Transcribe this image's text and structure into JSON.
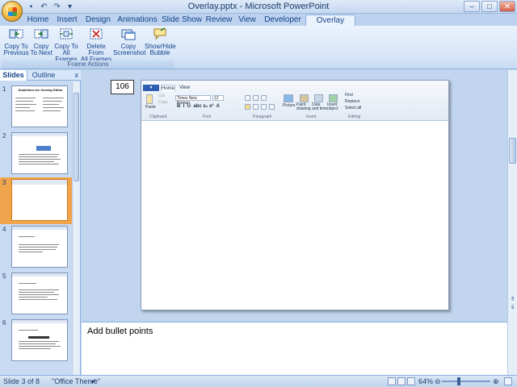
{
  "window": {
    "title": "Overlay.pptx - Microsoft PowerPoint",
    "buttons": [
      "–",
      "□",
      "✕"
    ]
  },
  "quick_access": [
    "save-icon",
    "undo-icon",
    "redo-icon",
    "customize-icon"
  ],
  "tabs": [
    {
      "label": "Home"
    },
    {
      "label": "Insert"
    },
    {
      "label": "Design"
    },
    {
      "label": "Animations"
    },
    {
      "label": "Slide Show"
    },
    {
      "label": "Review"
    },
    {
      "label": "View"
    },
    {
      "label": "Developer"
    },
    {
      "label": "Overlay Editor"
    }
  ],
  "active_tab": "Overlay Editor",
  "ribbon": {
    "group_label": "Frame Actions",
    "buttons": [
      {
        "line1": "Copy To",
        "line2": "Previous",
        "icon": "copy-previous-icon"
      },
      {
        "line1": "Copy",
        "line2": "To Next",
        "icon": "copy-next-icon"
      },
      {
        "line1": "Copy To",
        "line2": "All Frames",
        "icon": "copy-all-icon"
      },
      {
        "line1": "Delete From",
        "line2": "All Frames",
        "icon": "delete-all-icon"
      },
      {
        "line1": "Copy",
        "line2": "Screenshot",
        "icon": "screenshot-icon"
      },
      {
        "line1": "Show/Hide",
        "line2": "Bubble",
        "icon": "bubble-icon"
      }
    ]
  },
  "slides_pane": {
    "tab_slides": "Slides",
    "tab_outline": "Outline",
    "close": "x",
    "slides": [
      {
        "num": "1",
        "title": "Guidelines for Overlay Editor"
      },
      {
        "num": "2"
      },
      {
        "num": "3"
      },
      {
        "num": "4"
      },
      {
        "num": "5"
      },
      {
        "num": "6"
      }
    ],
    "selected_slide": 3
  },
  "slide": {
    "textbox": "106",
    "embedded": {
      "tabs": [
        "Home",
        "View"
      ],
      "font_name": "Times New Roman",
      "font_size": "12",
      "labels": {
        "clipboard": "Clipboard",
        "font": "Font",
        "paragraph": "Paragraph",
        "insert": "Insert",
        "editing": "Editing"
      },
      "buttons": {
        "paste": "Paste",
        "cut": "Cut",
        "copy": "Copy",
        "picture": "Picture",
        "paint": "Paint drawing",
        "datetime": "Date and time",
        "insert_object": "Insert object",
        "find": "Find",
        "replace": "Replace",
        "select_all": "Select all"
      }
    }
  },
  "notes": {
    "text": "Add bullet points"
  },
  "status": {
    "slide_info": "Slide 3 of 8",
    "theme": "\"Office Theme\"",
    "zoom": "64%"
  }
}
